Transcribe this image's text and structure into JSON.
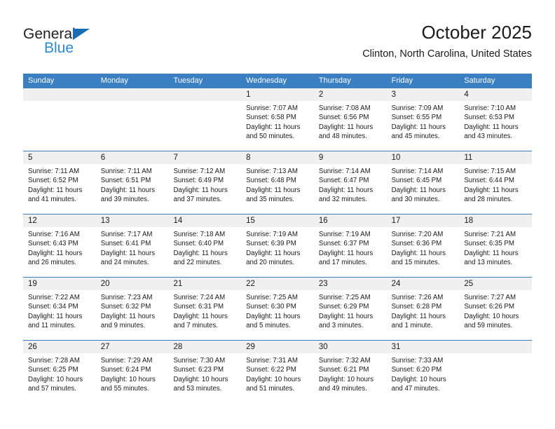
{
  "logo": {
    "word_top": "General",
    "word_bottom": "Blue",
    "triangle_icon": "blue-triangle-icon",
    "color_dark": "#231f20",
    "color_blue": "#2b8ad4",
    "color_triangle": "#1a6cb4"
  },
  "header": {
    "title": "October 2025",
    "subtitle": "Clinton, North Carolina, United States"
  },
  "theme": {
    "header_band": "#3a7fc1",
    "day_band": "#f0f0f0",
    "text": "#1a1a1a"
  },
  "weekdays": [
    "Sunday",
    "Monday",
    "Tuesday",
    "Wednesday",
    "Thursday",
    "Friday",
    "Saturday"
  ],
  "weeks": [
    [
      {
        "day": "",
        "sunrise": "",
        "sunset": "",
        "daylight_line1": "",
        "daylight_line2": ""
      },
      {
        "day": "",
        "sunrise": "",
        "sunset": "",
        "daylight_line1": "",
        "daylight_line2": ""
      },
      {
        "day": "",
        "sunrise": "",
        "sunset": "",
        "daylight_line1": "",
        "daylight_line2": ""
      },
      {
        "day": "1",
        "sunrise": "Sunrise: 7:07 AM",
        "sunset": "Sunset: 6:58 PM",
        "daylight_line1": "Daylight: 11 hours",
        "daylight_line2": "and 50 minutes."
      },
      {
        "day": "2",
        "sunrise": "Sunrise: 7:08 AM",
        "sunset": "Sunset: 6:56 PM",
        "daylight_line1": "Daylight: 11 hours",
        "daylight_line2": "and 48 minutes."
      },
      {
        "day": "3",
        "sunrise": "Sunrise: 7:09 AM",
        "sunset": "Sunset: 6:55 PM",
        "daylight_line1": "Daylight: 11 hours",
        "daylight_line2": "and 45 minutes."
      },
      {
        "day": "4",
        "sunrise": "Sunrise: 7:10 AM",
        "sunset": "Sunset: 6:53 PM",
        "daylight_line1": "Daylight: 11 hours",
        "daylight_line2": "and 43 minutes."
      }
    ],
    [
      {
        "day": "5",
        "sunrise": "Sunrise: 7:11 AM",
        "sunset": "Sunset: 6:52 PM",
        "daylight_line1": "Daylight: 11 hours",
        "daylight_line2": "and 41 minutes."
      },
      {
        "day": "6",
        "sunrise": "Sunrise: 7:11 AM",
        "sunset": "Sunset: 6:51 PM",
        "daylight_line1": "Daylight: 11 hours",
        "daylight_line2": "and 39 minutes."
      },
      {
        "day": "7",
        "sunrise": "Sunrise: 7:12 AM",
        "sunset": "Sunset: 6:49 PM",
        "daylight_line1": "Daylight: 11 hours",
        "daylight_line2": "and 37 minutes."
      },
      {
        "day": "8",
        "sunrise": "Sunrise: 7:13 AM",
        "sunset": "Sunset: 6:48 PM",
        "daylight_line1": "Daylight: 11 hours",
        "daylight_line2": "and 35 minutes."
      },
      {
        "day": "9",
        "sunrise": "Sunrise: 7:14 AM",
        "sunset": "Sunset: 6:47 PM",
        "daylight_line1": "Daylight: 11 hours",
        "daylight_line2": "and 32 minutes."
      },
      {
        "day": "10",
        "sunrise": "Sunrise: 7:14 AM",
        "sunset": "Sunset: 6:45 PM",
        "daylight_line1": "Daylight: 11 hours",
        "daylight_line2": "and 30 minutes."
      },
      {
        "day": "11",
        "sunrise": "Sunrise: 7:15 AM",
        "sunset": "Sunset: 6:44 PM",
        "daylight_line1": "Daylight: 11 hours",
        "daylight_line2": "and 28 minutes."
      }
    ],
    [
      {
        "day": "12",
        "sunrise": "Sunrise: 7:16 AM",
        "sunset": "Sunset: 6:43 PM",
        "daylight_line1": "Daylight: 11 hours",
        "daylight_line2": "and 26 minutes."
      },
      {
        "day": "13",
        "sunrise": "Sunrise: 7:17 AM",
        "sunset": "Sunset: 6:41 PM",
        "daylight_line1": "Daylight: 11 hours",
        "daylight_line2": "and 24 minutes."
      },
      {
        "day": "14",
        "sunrise": "Sunrise: 7:18 AM",
        "sunset": "Sunset: 6:40 PM",
        "daylight_line1": "Daylight: 11 hours",
        "daylight_line2": "and 22 minutes."
      },
      {
        "day": "15",
        "sunrise": "Sunrise: 7:19 AM",
        "sunset": "Sunset: 6:39 PM",
        "daylight_line1": "Daylight: 11 hours",
        "daylight_line2": "and 20 minutes."
      },
      {
        "day": "16",
        "sunrise": "Sunrise: 7:19 AM",
        "sunset": "Sunset: 6:37 PM",
        "daylight_line1": "Daylight: 11 hours",
        "daylight_line2": "and 17 minutes."
      },
      {
        "day": "17",
        "sunrise": "Sunrise: 7:20 AM",
        "sunset": "Sunset: 6:36 PM",
        "daylight_line1": "Daylight: 11 hours",
        "daylight_line2": "and 15 minutes."
      },
      {
        "day": "18",
        "sunrise": "Sunrise: 7:21 AM",
        "sunset": "Sunset: 6:35 PM",
        "daylight_line1": "Daylight: 11 hours",
        "daylight_line2": "and 13 minutes."
      }
    ],
    [
      {
        "day": "19",
        "sunrise": "Sunrise: 7:22 AM",
        "sunset": "Sunset: 6:34 PM",
        "daylight_line1": "Daylight: 11 hours",
        "daylight_line2": "and 11 minutes."
      },
      {
        "day": "20",
        "sunrise": "Sunrise: 7:23 AM",
        "sunset": "Sunset: 6:32 PM",
        "daylight_line1": "Daylight: 11 hours",
        "daylight_line2": "and 9 minutes."
      },
      {
        "day": "21",
        "sunrise": "Sunrise: 7:24 AM",
        "sunset": "Sunset: 6:31 PM",
        "daylight_line1": "Daylight: 11 hours",
        "daylight_line2": "and 7 minutes."
      },
      {
        "day": "22",
        "sunrise": "Sunrise: 7:25 AM",
        "sunset": "Sunset: 6:30 PM",
        "daylight_line1": "Daylight: 11 hours",
        "daylight_line2": "and 5 minutes."
      },
      {
        "day": "23",
        "sunrise": "Sunrise: 7:25 AM",
        "sunset": "Sunset: 6:29 PM",
        "daylight_line1": "Daylight: 11 hours",
        "daylight_line2": "and 3 minutes."
      },
      {
        "day": "24",
        "sunrise": "Sunrise: 7:26 AM",
        "sunset": "Sunset: 6:28 PM",
        "daylight_line1": "Daylight: 11 hours",
        "daylight_line2": "and 1 minute."
      },
      {
        "day": "25",
        "sunrise": "Sunrise: 7:27 AM",
        "sunset": "Sunset: 6:26 PM",
        "daylight_line1": "Daylight: 10 hours",
        "daylight_line2": "and 59 minutes."
      }
    ],
    [
      {
        "day": "26",
        "sunrise": "Sunrise: 7:28 AM",
        "sunset": "Sunset: 6:25 PM",
        "daylight_line1": "Daylight: 10 hours",
        "daylight_line2": "and 57 minutes."
      },
      {
        "day": "27",
        "sunrise": "Sunrise: 7:29 AM",
        "sunset": "Sunset: 6:24 PM",
        "daylight_line1": "Daylight: 10 hours",
        "daylight_line2": "and 55 minutes."
      },
      {
        "day": "28",
        "sunrise": "Sunrise: 7:30 AM",
        "sunset": "Sunset: 6:23 PM",
        "daylight_line1": "Daylight: 10 hours",
        "daylight_line2": "and 53 minutes."
      },
      {
        "day": "29",
        "sunrise": "Sunrise: 7:31 AM",
        "sunset": "Sunset: 6:22 PM",
        "daylight_line1": "Daylight: 10 hours",
        "daylight_line2": "and 51 minutes."
      },
      {
        "day": "30",
        "sunrise": "Sunrise: 7:32 AM",
        "sunset": "Sunset: 6:21 PM",
        "daylight_line1": "Daylight: 10 hours",
        "daylight_line2": "and 49 minutes."
      },
      {
        "day": "31",
        "sunrise": "Sunrise: 7:33 AM",
        "sunset": "Sunset: 6:20 PM",
        "daylight_line1": "Daylight: 10 hours",
        "daylight_line2": "and 47 minutes."
      },
      {
        "day": "",
        "sunrise": "",
        "sunset": "",
        "daylight_line1": "",
        "daylight_line2": ""
      }
    ]
  ]
}
